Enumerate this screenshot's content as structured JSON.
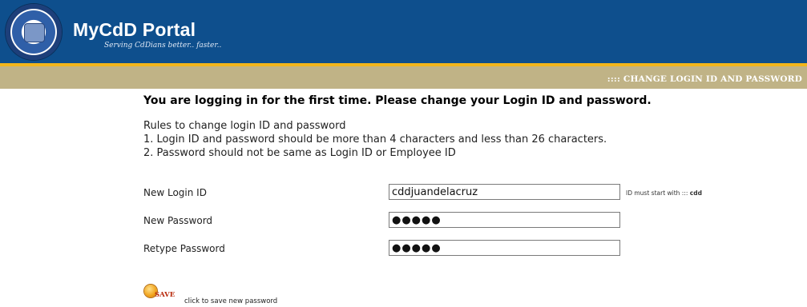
{
  "header": {
    "app_title": "MyCdD Portal",
    "tagline": "Serving CdDians better.. faster..",
    "logo_icon": "college-seal-logo",
    "colors": {
      "header_bg": "#0e4f8d",
      "accent_line": "#f2b61c",
      "nav_bar": "#c0b386"
    }
  },
  "section": {
    "title": ":::: CHANGE LOGIN ID AND PASSWORD"
  },
  "main": {
    "headline": "You are logging in for the first time. Please change your Login ID and password.",
    "rules_title": "Rules to change login ID and password",
    "rules": [
      "1. Login ID and password should be more than 4 characters and less than 26 characters.",
      "2. Password should not be same as Login ID or Employee ID"
    ]
  },
  "form": {
    "login_id": {
      "label": "New Login ID",
      "value": "cddjuandelacruz",
      "hint_prefix": "ID must start with :::",
      "hint_value": "cdd"
    },
    "new_password": {
      "label": "New Password",
      "value": "●●●●●"
    },
    "retype_password": {
      "label": "Retype Password",
      "value": "●●●●●"
    }
  },
  "save": {
    "label": "SAVE",
    "note": "click to save new password",
    "icon": "save-disk-icon"
  }
}
